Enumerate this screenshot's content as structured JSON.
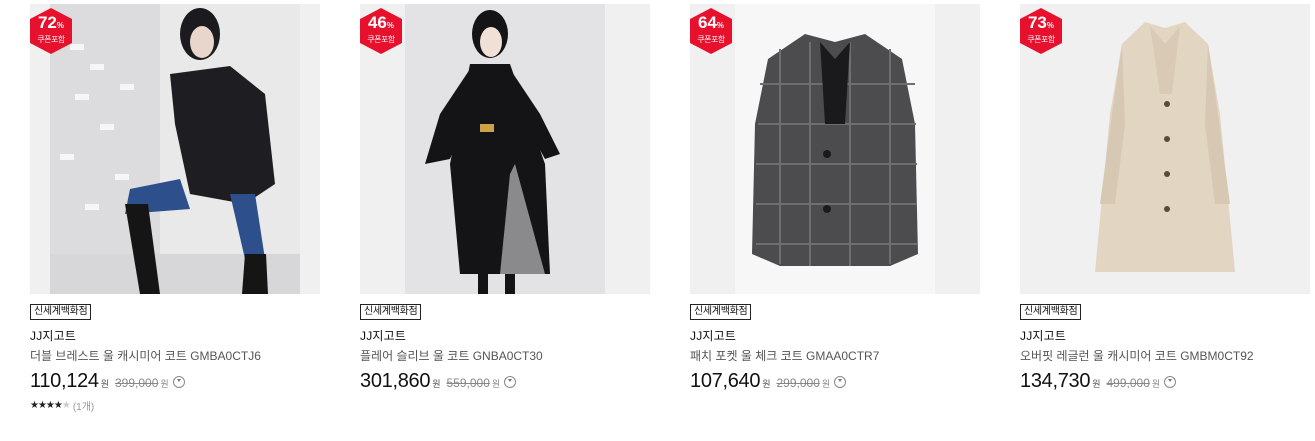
{
  "products": [
    {
      "discount": "72",
      "discount_unit": "%",
      "coupon_label": "쿠폰포함",
      "store": "신세계백화점",
      "brand": "JJ지고트",
      "name": "더블 브레스트 울 캐시미어 코트 GMBA0CTJ6",
      "price": "110,124",
      "price_unit": "원",
      "original_price": "399,000",
      "original_unit": "원",
      "rating_stars": 4,
      "review_count": "(1개)",
      "image": "model in black short coat, jeans, boots"
    },
    {
      "discount": "46",
      "discount_unit": "%",
      "coupon_label": "쿠폰포함",
      "store": "신세계백화점",
      "brand": "JJ지고트",
      "name": "플레어 슬리브 울 코트 GNBA0CT30",
      "price": "301,860",
      "price_unit": "원",
      "original_price": "559,000",
      "original_unit": "원",
      "image": "model in long black flare sleeve coat"
    },
    {
      "discount": "64",
      "discount_unit": "%",
      "coupon_label": "쿠폰포함",
      "store": "신세계백화점",
      "brand": "JJ지고트",
      "name": "패치 포켓 울 체크 코트 GMAA0CTR7",
      "price": "107,640",
      "price_unit": "원",
      "original_price": "299,000",
      "original_unit": "원",
      "image": "grey plaid check wool coat"
    },
    {
      "discount": "73",
      "discount_unit": "%",
      "coupon_label": "쿠폰포함",
      "store": "신세계백화점",
      "brand": "JJ지고트",
      "name": "오버핏 레글런 울 캐시미어 코트 GMBM0CT92",
      "price": "134,730",
      "price_unit": "원",
      "original_price": "499,000",
      "original_unit": "원",
      "image": "beige long cashmere coat"
    }
  ],
  "colors": {
    "badge": "#e8112d",
    "text": "#111111",
    "muted": "#888888"
  }
}
